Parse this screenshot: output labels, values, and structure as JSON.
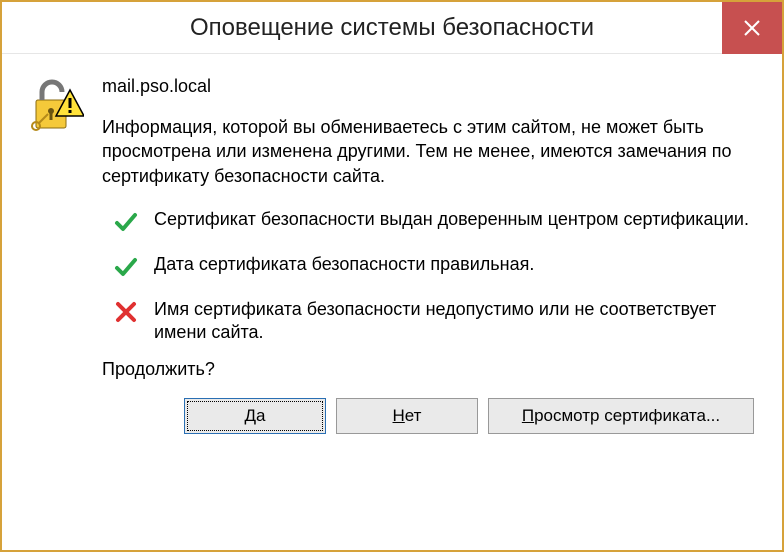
{
  "window": {
    "title": "Оповещение системы безопасности"
  },
  "content": {
    "site": "mail.pso.local",
    "info": "Информация, которой вы обмениваетесь с этим сайтом, не может быть просмотрена или изменена другими. Тем не менее, имеются замечания по сертификату безопасности сайта.",
    "checks": [
      {
        "status": "ok",
        "text": "Сертификат безопасности выдан доверенным центром сертификации."
      },
      {
        "status": "ok",
        "text": "Дата сертификата безопасности правильная."
      },
      {
        "status": "fail",
        "text": "Имя сертификата безопасности недопустимо или не соответствует имени сайта."
      }
    ],
    "continue": "Продолжить?"
  },
  "buttons": {
    "yes": "Да",
    "no": "Нет",
    "view_cert": "Просмотр сертификата..."
  },
  "accelerators": {
    "yes": "Д",
    "no": "Н",
    "view_cert": "П"
  }
}
